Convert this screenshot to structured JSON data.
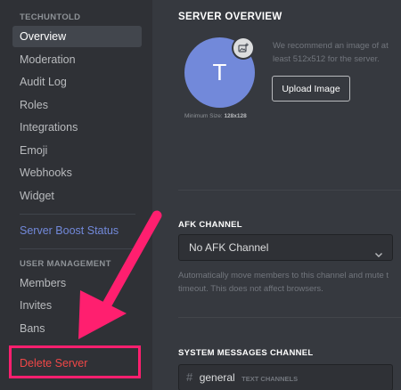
{
  "sidebar": {
    "server_name": "TECHUNTOLD",
    "items": [
      {
        "label": "Overview"
      },
      {
        "label": "Moderation"
      },
      {
        "label": "Audit Log"
      },
      {
        "label": "Roles"
      },
      {
        "label": "Integrations"
      },
      {
        "label": "Emoji"
      },
      {
        "label": "Webhooks"
      },
      {
        "label": "Widget"
      }
    ],
    "boost_label": "Server Boost Status",
    "user_management_header": "USER MANAGEMENT",
    "user_items": [
      {
        "label": "Members"
      },
      {
        "label": "Invites"
      },
      {
        "label": "Bans"
      }
    ],
    "delete_label": "Delete Server",
    "active_item": "Overview"
  },
  "overview": {
    "title": "SERVER OVERVIEW",
    "avatar_letter": "T",
    "min_size_label": "Minimum Size:",
    "min_size_value": "128x128",
    "recommend_text": "We recommend an image of at least 512x512 for the server.",
    "upload_button": "Upload Image"
  },
  "afk": {
    "title": "AFK CHANNEL",
    "selected": "No AFK Channel",
    "help_line1": "Automatically move members to this channel and mute t",
    "help_line2": "timeout. This does not affect browsers."
  },
  "system": {
    "title": "SYSTEM MESSAGES CHANNEL",
    "channel_name": "general",
    "channel_category": "TEXT CHANNELS"
  },
  "colors": {
    "sidebar_bg": "#2f3136",
    "content_bg": "#36393f",
    "brand": "#7289da",
    "danger": "#f04747",
    "annotation": "#ff1f6f"
  },
  "icons": {
    "avatar_upload": "image-add-icon",
    "dropdown": "chevron-down-icon",
    "channel": "hash-icon",
    "annotation_arrow": "arrow-icon"
  }
}
